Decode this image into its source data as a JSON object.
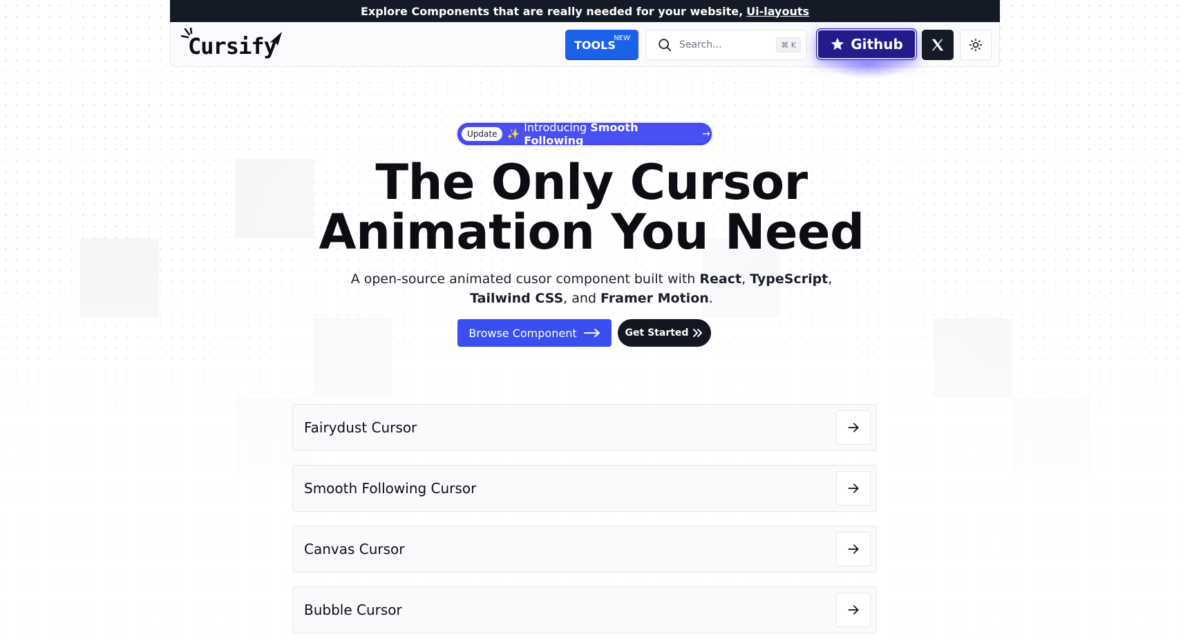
{
  "announcement": {
    "text": "Explore Components that are really needed for your website,",
    "link": "Ui-layouts"
  },
  "nav": {
    "logo_text": "Cursify",
    "tools_label": "TOOLS",
    "tools_badge": "NEW",
    "search_placeholder": "Search...",
    "search_shortcut": "⌘ K",
    "github_label": "Github"
  },
  "hero": {
    "pill_tag": "Update",
    "pill_text_1": "Introducing",
    "pill_text_2": "Smooth Following",
    "headline_line1": "The Only Cursor",
    "headline_line2": "Animation You Need",
    "sub_part1": "A open-source animated cusor component built with",
    "sub_react": "React",
    "sub_ts": "TypeScript",
    "sub_tailwind": "Tailwind CSS",
    "sub_and": ", and",
    "sub_framer": "Framer Motion",
    "browse_label": "Browse Component",
    "started_label": "Get Started"
  },
  "cursors": [
    {
      "label": "Fairydust Cursor"
    },
    {
      "label": "Smooth Following Cursor"
    },
    {
      "label": "Canvas Cursor"
    },
    {
      "label": "Bubble Cursor"
    }
  ],
  "colors": {
    "brand_blue": "#3b4ef0",
    "tools_blue": "#1c62e8",
    "dark": "#141a26",
    "github": "#241b8a"
  }
}
